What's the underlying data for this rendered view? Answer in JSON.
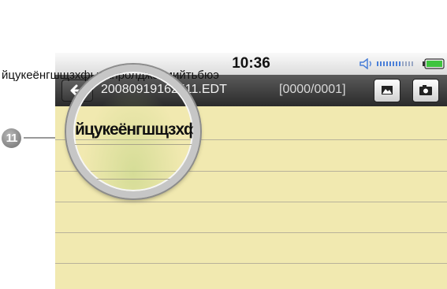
{
  "status_bar": {
    "time": "10:36",
    "volume_icon": "speaker-icon",
    "battery_icon": "battery-icon",
    "battery_color": "#3ec43e"
  },
  "toolbar": {
    "back_icon": "back-arrow-icon",
    "filename": "20080919162511.EDT",
    "page_counter": "[0000/0001]",
    "image_icon": "image-icon",
    "camera_icon": "camera-icon"
  },
  "note": {
    "text": "йцукеёнгшщзхфывапролджэсмийтьбюэ",
    "magnified_text": "йцукеёнгшщзхфыва"
  },
  "callout": {
    "number": "11"
  },
  "colors": {
    "paper": "#f1e9b0",
    "toolbar": "#3a3a3a"
  }
}
